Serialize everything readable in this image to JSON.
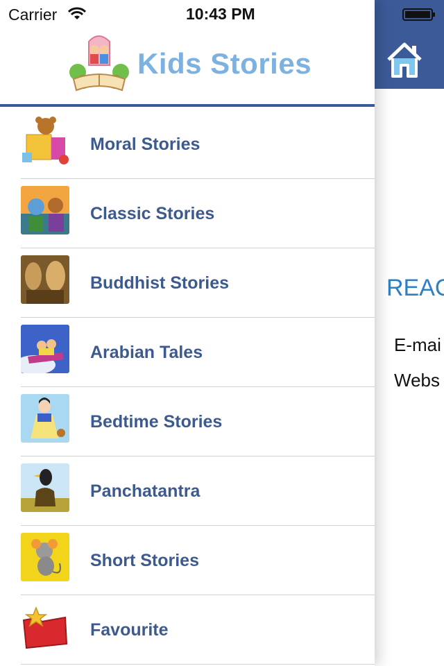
{
  "status_bar": {
    "carrier": "Carrier",
    "time": "10:43 PM"
  },
  "app": {
    "title": "Kids Stories"
  },
  "menu": {
    "items": [
      {
        "label": "Moral Stories",
        "icon": "toy-block-bear-icon"
      },
      {
        "label": "Classic Stories",
        "icon": "classic-characters-icon"
      },
      {
        "label": "Buddhist Stories",
        "icon": "buddha-statue-icon"
      },
      {
        "label": "Arabian Tales",
        "icon": "magic-carpet-icon"
      },
      {
        "label": "Bedtime Stories",
        "icon": "princess-icon"
      },
      {
        "label": "Panchatantra",
        "icon": "crow-pot-icon"
      },
      {
        "label": "Short Stories",
        "icon": "mouse-cartoon-icon"
      },
      {
        "label": "Favourite",
        "icon": "star-folder-icon"
      }
    ]
  },
  "content": {
    "heading": "REAC",
    "lines": [
      "E-mai",
      "Webs"
    ]
  },
  "colors": {
    "header_blue": "#3d5a98",
    "menu_text": "#3d5a8f",
    "title": "#7db1e0",
    "heading": "#2f7fc1"
  }
}
